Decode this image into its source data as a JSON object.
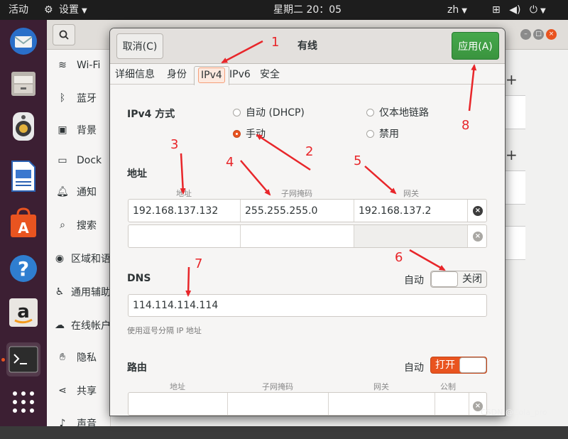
{
  "topbar": {
    "activities": "活动",
    "app_menu": "设置",
    "clock": "星期二 20：05",
    "input_method": "zh"
  },
  "dock": {
    "icons": [
      "thunderbird-icon",
      "files-icon",
      "rhythmbox-icon",
      "writer-icon",
      "software-center-icon",
      "help-icon",
      "amazon-icon",
      "terminal-icon",
      "app-grid-icon"
    ]
  },
  "settings_sidebar": {
    "items": [
      {
        "label": "Wi-Fi",
        "icon": "wifi-icon"
      },
      {
        "label": "蓝牙",
        "icon": "bluetooth-icon"
      },
      {
        "label": "背景",
        "icon": "background-icon"
      },
      {
        "label": "Dock",
        "icon": "dock-icon"
      },
      {
        "label": "通知",
        "icon": "bell-icon"
      },
      {
        "label": "搜索",
        "icon": "search-icon"
      },
      {
        "label": "区域和语",
        "icon": "region-icon"
      },
      {
        "label": "通用辅助",
        "icon": "accessibility-icon"
      },
      {
        "label": "在线帐户",
        "icon": "online-accounts-icon"
      },
      {
        "label": "隐私",
        "icon": "privacy-hand-icon"
      },
      {
        "label": "共享",
        "icon": "share-icon"
      },
      {
        "label": "声音",
        "icon": "sound-icon"
      }
    ]
  },
  "dialog": {
    "title": "有线",
    "cancel_label": "取消(C)",
    "apply_label": "应用(A)",
    "tabs": [
      "详细信息",
      "身份",
      "IPv4",
      "IPv6",
      "安全"
    ],
    "active_tab": "IPv4",
    "ipv4_method": {
      "label": "IPv4 方式",
      "options": [
        {
          "label": "自动 (DHCP)",
          "selected": false
        },
        {
          "label": "仅本地链路",
          "selected": false
        },
        {
          "label": "手动",
          "selected": true
        },
        {
          "label": "禁用",
          "selected": false
        }
      ]
    },
    "addresses": {
      "label": "地址",
      "col_address": "地址",
      "col_netmask": "子网掩码",
      "col_gateway": "网关",
      "rows": [
        {
          "address": "192.168.137.132",
          "netmask": "255.255.255.0",
          "gateway": "192.168.137.2"
        },
        {
          "address": "",
          "netmask": "",
          "gateway": ""
        }
      ]
    },
    "dns": {
      "label": "DNS",
      "auto_label": "自动",
      "switch_state": "关闭",
      "value": "114.114.114.114",
      "hint": "使用逗号分隔 IP 地址"
    },
    "routes": {
      "label": "路由",
      "auto_label": "自动",
      "switch_state": "打开",
      "col_address": "地址",
      "col_netmask": "子网掩码",
      "col_gateway": "网关",
      "col_metric": "公制"
    }
  },
  "annotations": [
    "1",
    "2",
    "3",
    "4",
    "5",
    "6",
    "7",
    "8"
  ],
  "watermark": "CSDN @Cola_pro",
  "colors": {
    "accent": "#e95420",
    "apply_green": "#3fa044",
    "annotation_red": "#e8262a"
  }
}
